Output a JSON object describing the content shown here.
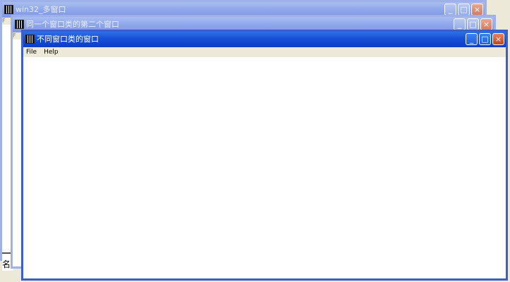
{
  "windows": {
    "back": {
      "title": "win32_多窗口",
      "menu_stub": "F",
      "status_text": "名称"
    },
    "middle": {
      "title": "同一个窗口类的第二个窗口",
      "menu_stub": "F"
    },
    "front": {
      "title": "不同窗口类的窗口",
      "menu": [
        "File",
        "Help"
      ]
    }
  },
  "caption_buttons": {
    "minimize": "_",
    "maximize": "□",
    "close": "×"
  },
  "icons": {
    "app": "application-icon"
  }
}
